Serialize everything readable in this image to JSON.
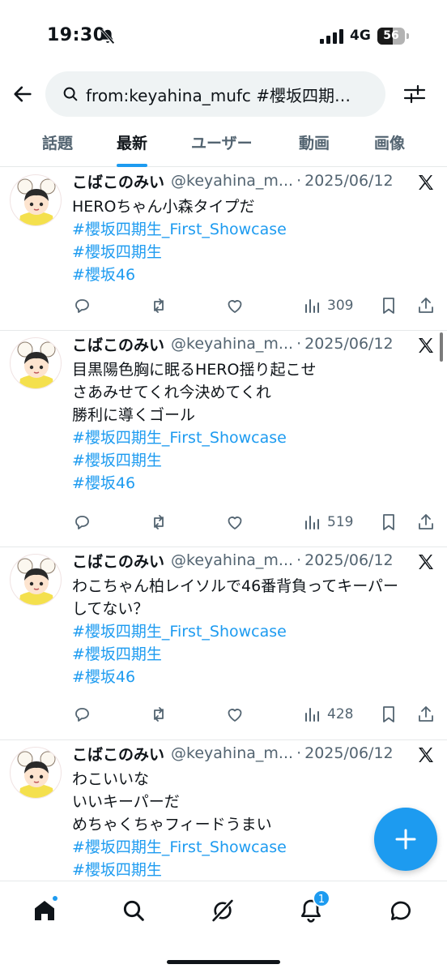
{
  "status_bar": {
    "time": "19:30",
    "network": "4G",
    "battery": "56",
    "battery_level": 0.56
  },
  "search": {
    "query": "from:keyahina_mufc  #櫻坂四期生_First_Showcase"
  },
  "tabs": [
    {
      "label": "話題",
      "active": false
    },
    {
      "label": "最新",
      "active": true
    },
    {
      "label": "ユーザー",
      "active": false
    },
    {
      "label": "動画",
      "active": false
    },
    {
      "label": "画像",
      "active": false
    }
  ],
  "tweets": [
    {
      "name": "こばこのみい",
      "handle": "@keyahina_m...",
      "date": "2025/06/12",
      "lines": [
        "HEROちゃん小森タイプだ"
      ],
      "hashtags": [
        "#櫻坂四期生_First_Showcase",
        "#櫻坂四期生",
        "#櫻坂46"
      ],
      "views": "309"
    },
    {
      "name": "こばこのみい",
      "handle": "@keyahina_m...",
      "date": "2025/06/12",
      "lines": [
        "目黒陽色胸に眠るHERO揺り起こせ",
        "さあみせてくれ今決めてくれ",
        "勝利に導くゴール"
      ],
      "hashtags": [
        "#櫻坂四期生_First_Showcase",
        "#櫻坂四期生",
        "#櫻坂46"
      ],
      "views": "519"
    },
    {
      "name": "こばこのみい",
      "handle": "@keyahina_m...",
      "date": "2025/06/12",
      "lines": [
        "わこちゃん柏レイソルで46番背負ってキーパー",
        "してない？"
      ],
      "hashtags": [
        "#櫻坂四期生_First_Showcase",
        "#櫻坂四期生",
        "#櫻坂46"
      ],
      "views": "428"
    },
    {
      "name": "こばこのみい",
      "handle": "@keyahina_m...",
      "date": "2025/06/12",
      "lines": [
        "わこいいな",
        "いいキーパーだ",
        "めちゃくちゃフィードうまい"
      ],
      "hashtags": [
        "#櫻坂四期生_First_Showcase",
        "#櫻坂四期生"
      ],
      "views": ""
    }
  ],
  "bottom_nav": {
    "items": [
      "home-icon",
      "search-icon",
      "grok-icon",
      "notifications-icon",
      "messages-icon"
    ],
    "notification_count": "1"
  },
  "colors": {
    "accent": "#1d9bf0",
    "text": "#0f1419",
    "muted": "#536471"
  }
}
